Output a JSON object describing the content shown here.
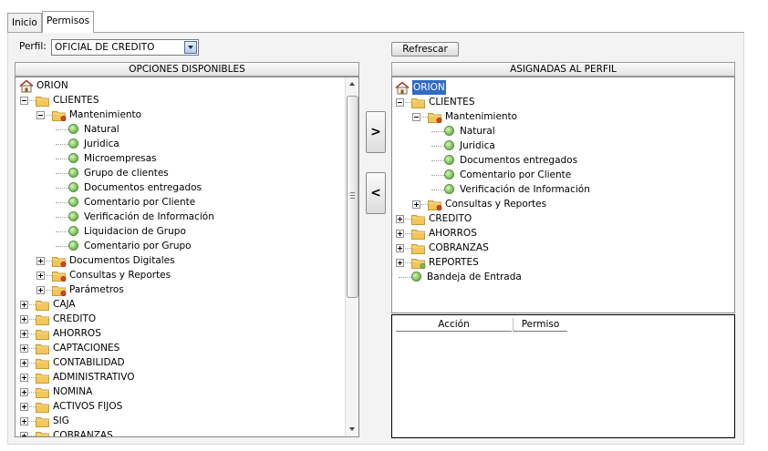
{
  "tabs": {
    "inicio": "Inicio",
    "permisos": "Permisos"
  },
  "perfil": {
    "label": "Perfil:",
    "value": "OFICIAL DE CREDITO"
  },
  "refresh_label": "Refrescar",
  "left_header": "OPCIONES DISPONIBLES",
  "right_header": "ASIGNADAS AL PERFIL",
  "move_right_label": ">",
  "move_left_label": "<",
  "left_tree": [
    {
      "label": "ORION",
      "type": "root",
      "level": 0
    },
    {
      "label": "CLIENTES",
      "type": "folder",
      "level": 1,
      "expanded": true
    },
    {
      "label": "Mantenimiento",
      "type": "folder-red",
      "level": 2,
      "expanded": true
    },
    {
      "label": "Natural",
      "type": "leaf",
      "level": 3
    },
    {
      "label": "Juridica",
      "type": "leaf",
      "level": 3
    },
    {
      "label": "Microempresas",
      "type": "leaf",
      "level": 3
    },
    {
      "label": "Grupo de clientes",
      "type": "leaf",
      "level": 3
    },
    {
      "label": "Documentos entregados",
      "type": "leaf",
      "level": 3
    },
    {
      "label": "Comentario por Cliente",
      "type": "leaf",
      "level": 3
    },
    {
      "label": "Verificación de Información",
      "type": "leaf",
      "level": 3
    },
    {
      "label": "Liquidacion de Grupo",
      "type": "leaf",
      "level": 3
    },
    {
      "label": "Comentario por Grupo",
      "type": "leaf",
      "level": 3
    },
    {
      "label": "Documentos Digitales",
      "type": "folder-red",
      "level": 2,
      "expanded": false
    },
    {
      "label": "Consultas y Reportes",
      "type": "folder-red",
      "level": 2,
      "expanded": false
    },
    {
      "label": "Parámetros",
      "type": "folder-red",
      "level": 2,
      "expanded": false
    },
    {
      "label": "CAJA",
      "type": "folder",
      "level": 1,
      "expanded": false
    },
    {
      "label": "CREDITO",
      "type": "folder",
      "level": 1,
      "expanded": false
    },
    {
      "label": "AHORROS",
      "type": "folder",
      "level": 1,
      "expanded": false
    },
    {
      "label": "CAPTACIONES",
      "type": "folder",
      "level": 1,
      "expanded": false
    },
    {
      "label": "CONTABILIDAD",
      "type": "folder",
      "level": 1,
      "expanded": false
    },
    {
      "label": "ADMINISTRATIVO",
      "type": "folder",
      "level": 1,
      "expanded": false
    },
    {
      "label": "NOMINA",
      "type": "folder",
      "level": 1,
      "expanded": false
    },
    {
      "label": "ACTIVOS FIJOS",
      "type": "folder",
      "level": 1,
      "expanded": false
    },
    {
      "label": "SIG",
      "type": "folder",
      "level": 1,
      "expanded": false
    },
    {
      "label": "COBRANZAS",
      "type": "folder",
      "level": 1,
      "expanded": false
    }
  ],
  "right_tree": [
    {
      "label": "ORION",
      "type": "root",
      "level": 0,
      "selected": true
    },
    {
      "label": "CLIENTES",
      "type": "folder",
      "level": 1,
      "expanded": true
    },
    {
      "label": "Mantenimiento",
      "type": "folder-red",
      "level": 2,
      "expanded": true
    },
    {
      "label": "Natural",
      "type": "leaf",
      "level": 3
    },
    {
      "label": "Juridica",
      "type": "leaf",
      "level": 3
    },
    {
      "label": "Documentos entregados",
      "type": "leaf",
      "level": 3
    },
    {
      "label": "Comentario por Cliente",
      "type": "leaf",
      "level": 3
    },
    {
      "label": "Verificación de Información",
      "type": "leaf",
      "level": 3
    },
    {
      "label": "Consultas y Reportes",
      "type": "folder-red",
      "level": 2,
      "expanded": false
    },
    {
      "label": "CREDITO",
      "type": "folder",
      "level": 1,
      "expanded": false
    },
    {
      "label": "AHORROS",
      "type": "folder",
      "level": 1,
      "expanded": false
    },
    {
      "label": "COBRANZAS",
      "type": "folder",
      "level": 1,
      "expanded": false
    },
    {
      "label": "REPORTES",
      "type": "folder-green",
      "level": 1,
      "expanded": false
    },
    {
      "label": "Bandeja de Entrada",
      "type": "leaf",
      "level": 1
    }
  ],
  "permissions_table": {
    "columns": [
      "Acción",
      "Permiso"
    ],
    "rows": []
  },
  "colors": {
    "selection": "#316ac5",
    "folder": "#f2c65a",
    "leaf": "#7cc65a",
    "badge_red": "#d8402c"
  }
}
